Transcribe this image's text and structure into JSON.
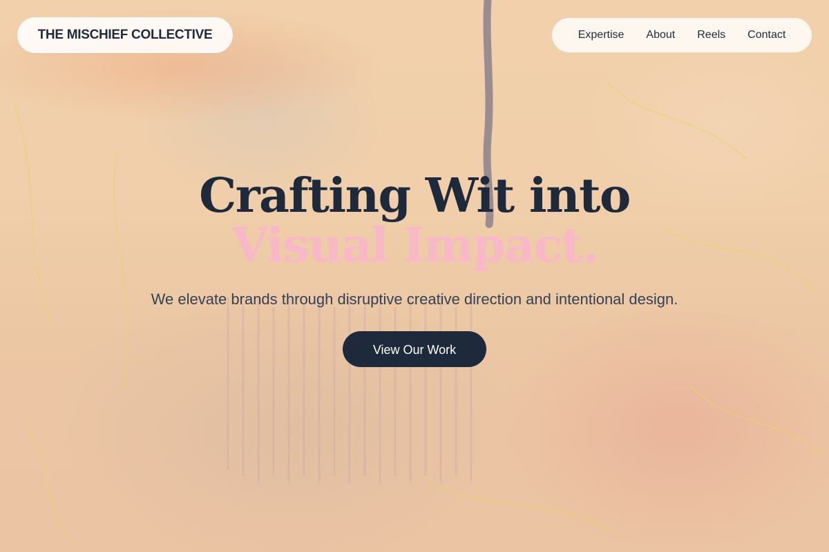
{
  "brand": {
    "name": "THE MISCHIEF COLLECTIVE"
  },
  "nav": {
    "items": [
      {
        "label": "Expertise"
      },
      {
        "label": "About"
      },
      {
        "label": "Reels"
      },
      {
        "label": "Contact"
      }
    ]
  },
  "hero": {
    "headline_line1": "Crafting Wit into",
    "headline_line2": "Visual Impact.",
    "subtitle": "We elevate brands through disruptive creative direction and intentional design.",
    "cta_label": "View Our Work"
  },
  "colors": {
    "text_dark": "#1e293b",
    "accent_pink": "#f9b8c8",
    "background": "#f0cfaa",
    "pill_background": "#ffffff"
  }
}
